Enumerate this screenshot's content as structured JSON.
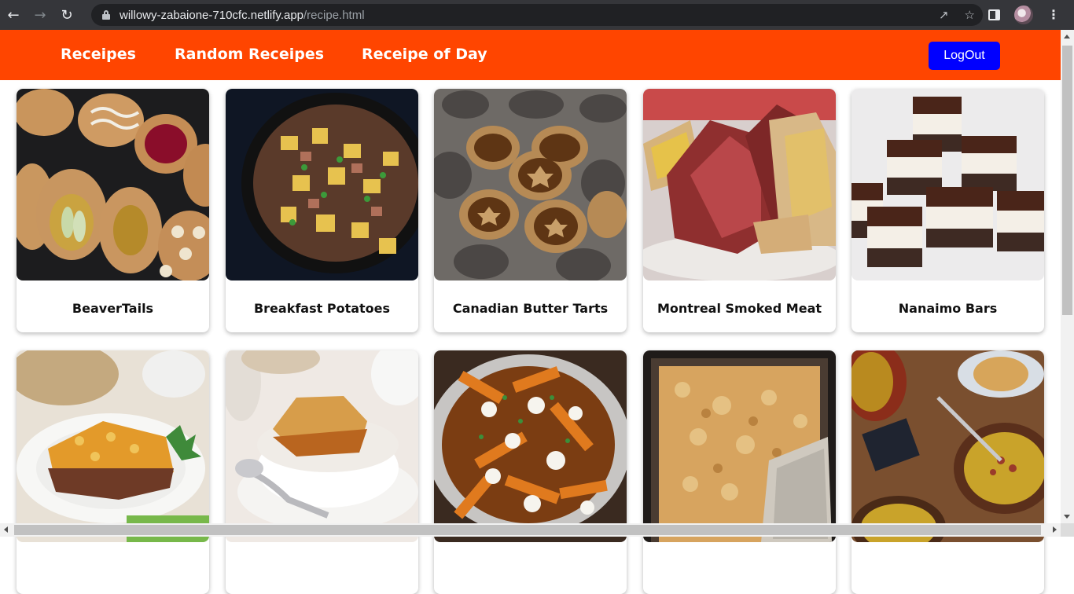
{
  "browser": {
    "url_host": "willowy-zabaione-710cfc.netlify.app",
    "url_path": "/recipe.html"
  },
  "header": {
    "nav": [
      "Receipes",
      "Random Receipes",
      "Receipe of Day"
    ],
    "logout_label": "LogOut",
    "bg_color": "#ff4500",
    "button_color": "#0000ff"
  },
  "cards": [
    {
      "title": "BeaverTails",
      "image": "beavertails-photo"
    },
    {
      "title": "Breakfast Potatoes",
      "image": "breakfast-potatoes-photo"
    },
    {
      "title": "Canadian Butter Tarts",
      "image": "butter-tarts-photo"
    },
    {
      "title": "Montreal Smoked Meat",
      "image": "smoked-meat-photo"
    },
    {
      "title": "Nanaimo Bars",
      "image": "nanaimo-bars-photo"
    },
    {
      "title": "",
      "image": "shepherds-pie-photo"
    },
    {
      "title": "",
      "image": "pudding-chomeur-photo"
    },
    {
      "title": "",
      "image": "poutine-photo"
    },
    {
      "title": "",
      "image": "tourtiere-photo"
    },
    {
      "title": "",
      "image": "pea-soup-photo"
    }
  ]
}
